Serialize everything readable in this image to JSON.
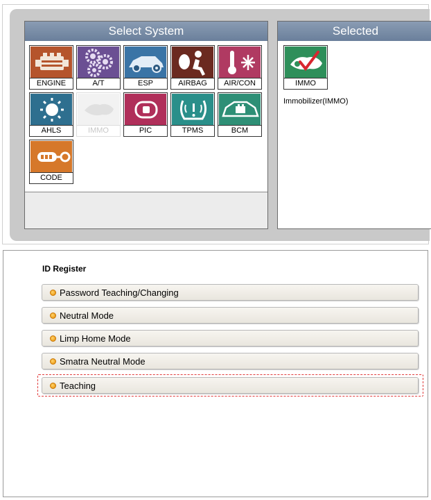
{
  "select_system": {
    "title": "Select System",
    "tiles": [
      {
        "label": "ENGINE",
        "color": "#b5542c",
        "icon": "engine-icon",
        "enabled": true
      },
      {
        "label": "A/T",
        "color": "#6b4f93",
        "icon": "gears-icon",
        "enabled": true
      },
      {
        "label": "ESP",
        "color": "#3a74a6",
        "icon": "car-esp-icon",
        "enabled": true
      },
      {
        "label": "AIRBAG",
        "color": "#6b2a20",
        "icon": "airbag-icon",
        "enabled": true
      },
      {
        "label": "AIR/CON",
        "color": "#b03a62",
        "icon": "aircon-icon",
        "enabled": true
      },
      {
        "label": "AHLS",
        "color": "#2e6f8f",
        "icon": "headlamp-icon",
        "enabled": true
      },
      {
        "label": "IMMO",
        "color": "#e8e8e8",
        "icon": "immo-key-icon",
        "enabled": false
      },
      {
        "label": "PIC",
        "color": "#b02f5a",
        "icon": "smart-key-icon",
        "enabled": true
      },
      {
        "label": "TPMS",
        "color": "#2a8f8a",
        "icon": "tire-pressure-icon",
        "enabled": true
      },
      {
        "label": "BCM",
        "color": "#2e8f76",
        "icon": "body-control-icon",
        "enabled": true
      },
      {
        "label": "CODE",
        "color": "#d6782a",
        "icon": "code-key-icon",
        "enabled": true
      }
    ]
  },
  "selected": {
    "title": "Selected",
    "tile": {
      "label": "IMMO",
      "color": "#2e8f5a",
      "icon": "immo-check-icon"
    },
    "caption": "Immobilizer(IMMO)"
  },
  "id_register": {
    "title": "ID Register",
    "items": [
      "Password Teaching/Changing",
      "Neutral Mode",
      "Limp Home Mode",
      "Smatra Neutral Mode",
      "Teaching"
    ]
  }
}
